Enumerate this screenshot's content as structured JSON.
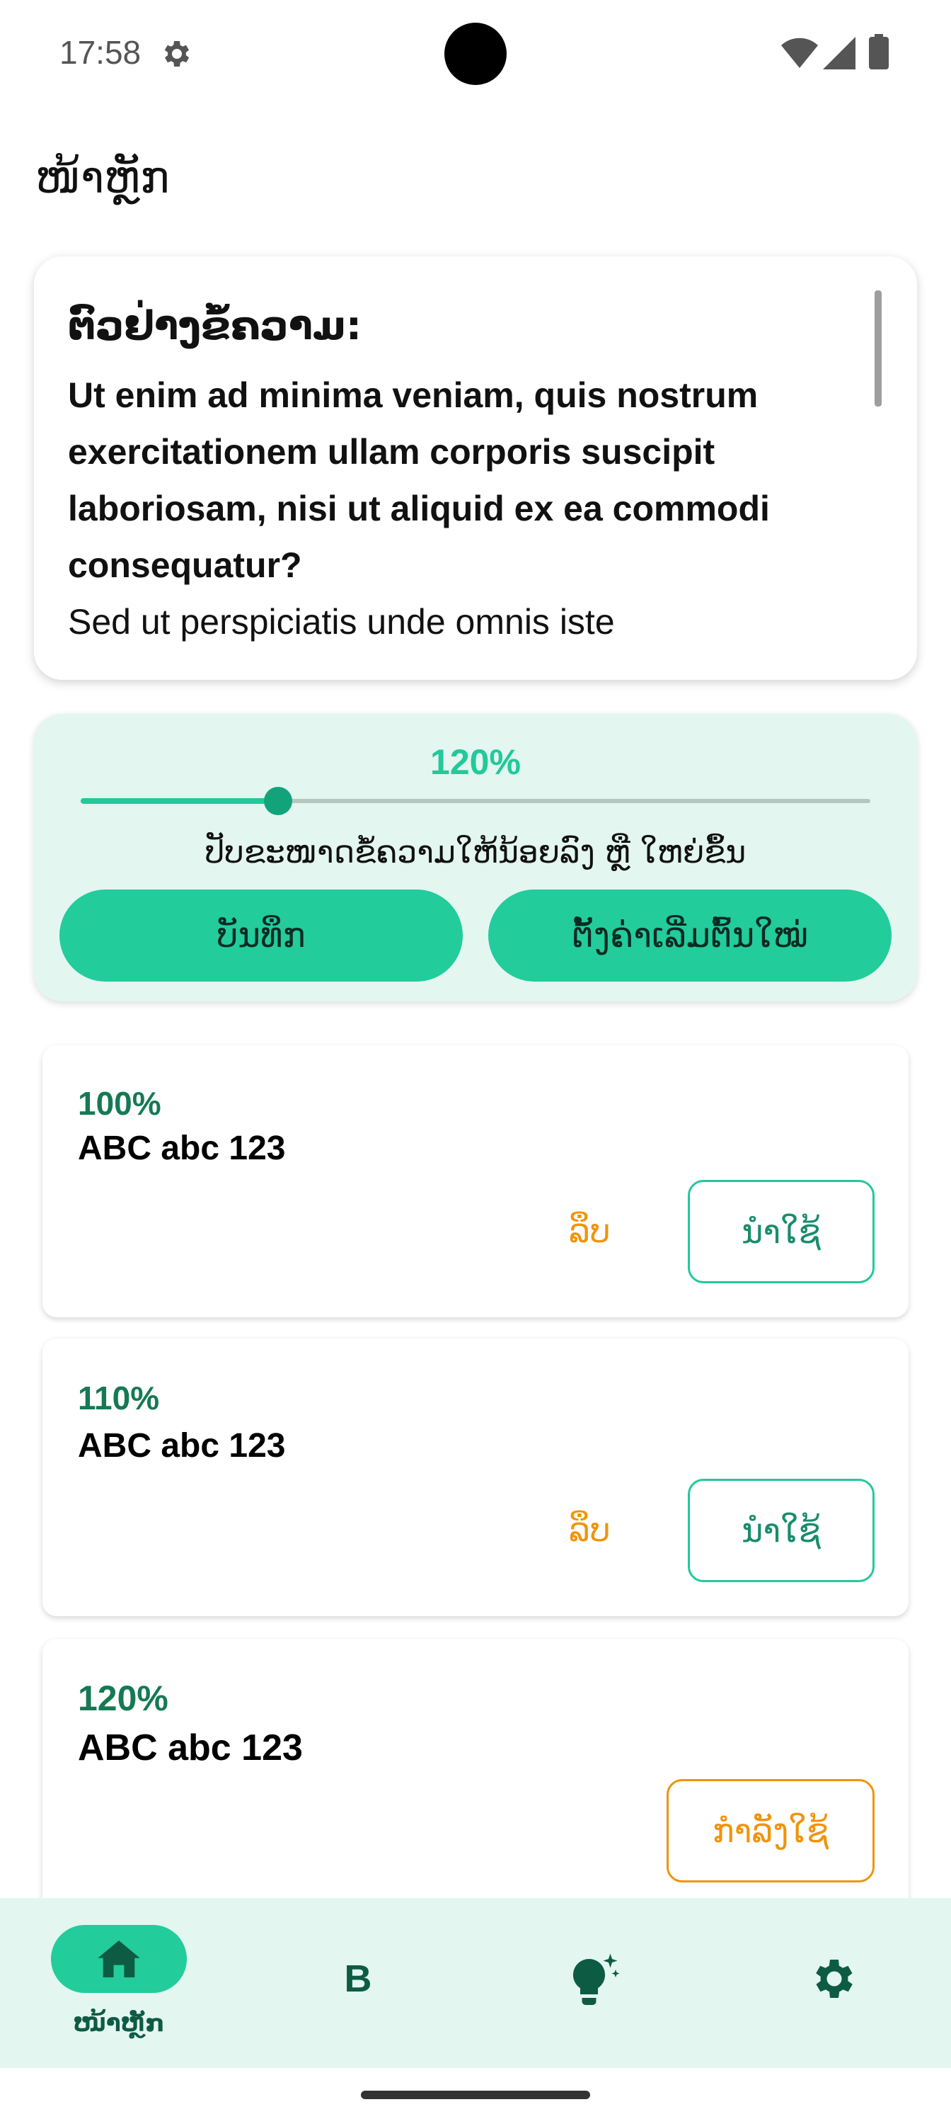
{
  "status_bar": {
    "time": "17:58"
  },
  "header": {
    "title": "ໜ້າຫຼັກ"
  },
  "preview": {
    "heading": "ຕົວຢ່າງຂໍ້ຄວາມ:",
    "bold_text": "Ut enim ad minima veniam, quis nostrum exercitationem ullam corporis suscipit laboriosam, nisi ut aliquid ex ea commodi consequatur?",
    "regular_text": "Sed ut perspiciatis unde omnis iste"
  },
  "slider_panel": {
    "zoom_label": "120%",
    "zoom_fraction": 0.25,
    "hint": "ປັບຂະໜາດຂໍ້ຄວາມໃຫ້ນ້ອຍລົງ ຫຼື ໃຫຍ່ຂຶ້ນ",
    "save_label": "ບັນທຶກ",
    "reset_label": "ຕັ້ງຄ່າເລີ່ມຕົ້ນໃໝ່"
  },
  "presets": [
    {
      "percent": "100%",
      "sample": "ABC abc 123",
      "delete_label": "ລຶບ",
      "apply_label": "ນຳໃຊ້"
    },
    {
      "percent": "110%",
      "sample": "ABC abc 123",
      "delete_label": "ລຶບ",
      "apply_label": "ນຳໃຊ້"
    },
    {
      "percent": "120%",
      "sample": "ABC abc 123",
      "active_label": "ກຳລັງໃຊ້"
    }
  ],
  "bottom_nav": {
    "home_label": "ໜ້າຫຼັກ",
    "bold_glyph": "B",
    "items": [
      "home-icon",
      "bold-icon",
      "lightbulb-sparkle-icon",
      "gear-icon"
    ]
  },
  "colors": {
    "accent": "#22cc9b",
    "accent_dark": "#157a54",
    "warning": "#f0940c",
    "panel_bg": "#e3f6f0"
  }
}
